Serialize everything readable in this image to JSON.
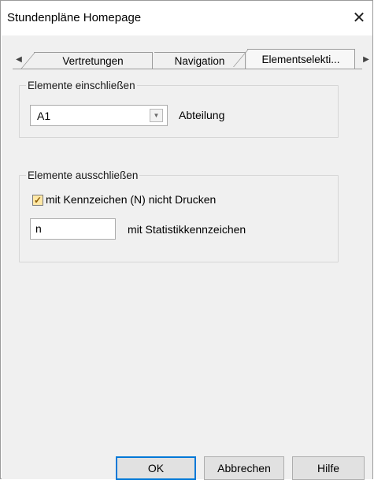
{
  "window": {
    "title": "Stundenpläne Homepage",
    "close_glyph": "✕"
  },
  "tabs": [
    {
      "label": "Vertretungen",
      "active": false
    },
    {
      "label": "Navigation",
      "active": false
    },
    {
      "label": "Elementselekti...",
      "active": true
    }
  ],
  "scroll": {
    "left_glyph": "◀",
    "right_glyph": "▶"
  },
  "include": {
    "legend": "Elemente einschließen",
    "combo_value": "A1",
    "combo_glyph": "▼",
    "label": "Abteilung"
  },
  "exclude": {
    "legend": "Elemente ausschließen",
    "checkbox_checked": true,
    "checkbox_glyph": "✓",
    "checkbox_label": "mit Kennzeichen (N) nicht Drucken",
    "field_value": "n",
    "field_label": "mit Statistikkennzeichen"
  },
  "footer": {
    "ok": "OK",
    "cancel": "Abbrechen",
    "help": "Hilfe"
  },
  "colors": {
    "checkbox_fill": "#ffe8a6",
    "default_button_border": "#0078d7"
  }
}
